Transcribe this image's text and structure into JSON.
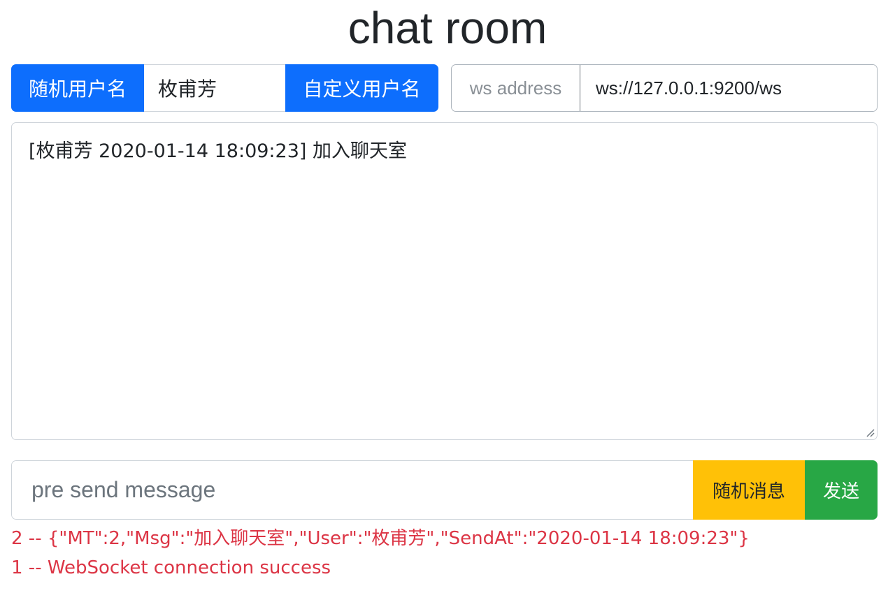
{
  "page": {
    "title": "chat room"
  },
  "user": {
    "random_label": "随机用户名",
    "name_value": "枚甫芳",
    "custom_label": "自定义用户名"
  },
  "ws": {
    "label": "ws address",
    "address_value": "ws://127.0.0.1:9200/ws"
  },
  "chat": {
    "messages": [
      "[枚甫芳 2020-01-14 18:09:23] 加入聊天室"
    ]
  },
  "send": {
    "placeholder": "pre send message",
    "random_label": "随机消息",
    "send_label": "发送"
  },
  "log": {
    "lines": [
      "2 -- {\"MT\":2,\"Msg\":\"加入聊天室\",\"User\":\"枚甫芳\",\"SendAt\":\"2020-01-14 18:09:23\"}",
      "1 -- WebSocket connection success"
    ]
  },
  "colors": {
    "primary": "#0d6efd",
    "warning": "#ffc107",
    "success": "#28a745",
    "danger": "#dc3545"
  }
}
